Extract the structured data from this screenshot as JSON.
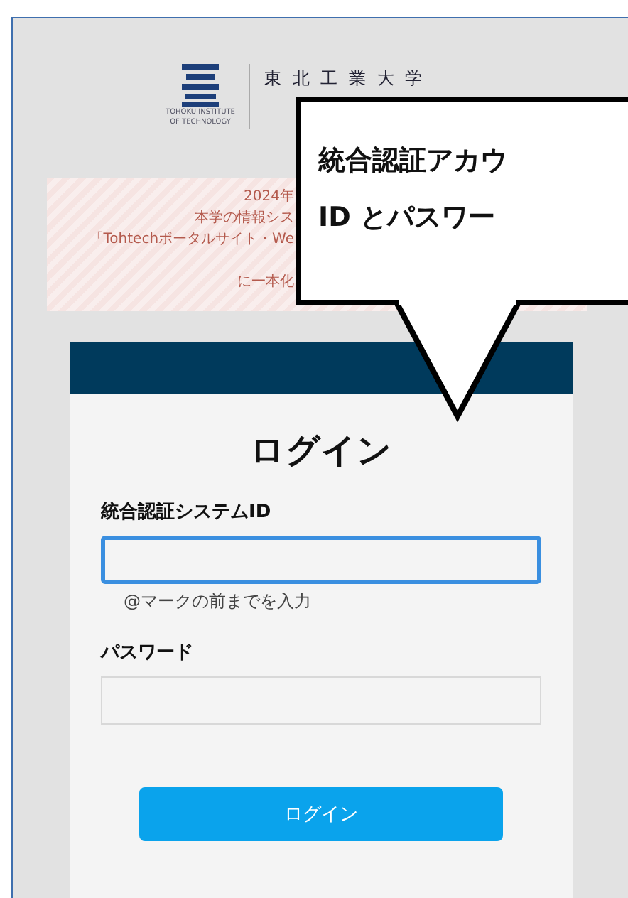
{
  "logo": {
    "caption": [
      "TOHOKU INSTITUTE",
      "OF TECHNOLOGY"
    ],
    "name": "東 北 工 業 大 学"
  },
  "notice": {
    "lines": [
      "2024年",
      "本学の情報シス",
      "「Tohtechポータルサイト・We",
      "に一本化"
    ]
  },
  "callout": {
    "lines": [
      "統合認証アカウ",
      "ID とパスワー"
    ]
  },
  "login": {
    "title": "ログイン",
    "fields": [
      {
        "label": "統合認証システムID",
        "focused": true,
        "hint": "@マークの前までを入力"
      },
      {
        "label": "パスワード",
        "focused": false
      }
    ],
    "button": "ログイン"
  }
}
